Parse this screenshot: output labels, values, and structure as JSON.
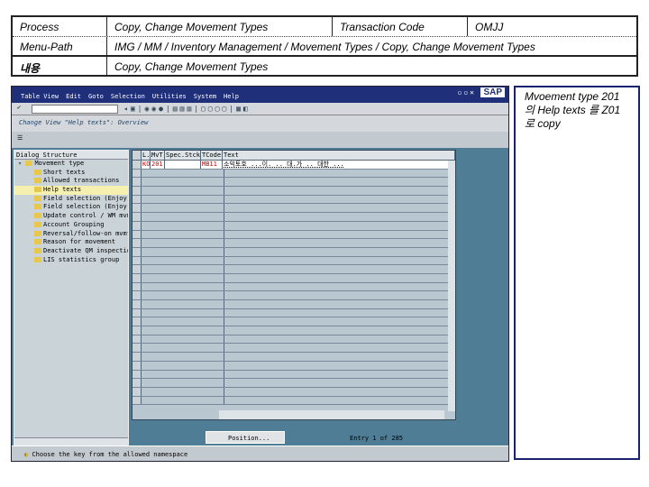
{
  "header": {
    "process_label": "Process",
    "process_value": "Copy, Change Movement Types",
    "tcode_label": "Transaction Code",
    "tcode_value": "OMJJ",
    "menupath_label": "Menu-Path",
    "menupath_value": "IMG / MM / Inventory Management / Movement Types / Copy, Change Movement Types",
    "content_label": "내용",
    "content_value": "Copy, Change Movement Types"
  },
  "sap": {
    "menu": [
      "Table View",
      "Edit",
      "Goto",
      "Selection",
      "Utilities",
      "System",
      "Help"
    ],
    "logo": "SAP",
    "screen_title": "Change View \"Help texts\": Overview",
    "tree": {
      "title": "Dialog Structure",
      "root": "Movement type",
      "items": [
        "Short texts",
        "Allowed transactions",
        "Help texts",
        "Field selection (Enjoy)",
        "Field selection (Enjoy)",
        "Update control / WM mvmt",
        "Account Grouping",
        "Reversal/follow-on mvmt",
        "Reason for movement",
        "Deactivate QM inspection",
        "LIS statistics group"
      ]
    },
    "table": {
      "columns": [
        "L..",
        "MvT",
        "Spec.Stck",
        "TCode",
        "Text"
      ],
      "row": {
        "lang": "KO",
        "mvt": "201",
        "spec": "",
        "tcode": "MB11",
        "text": "소익토호 ...이. .. 대.가 .. 대한 ..."
      }
    },
    "position_label": "Position...",
    "entry_text": "Entry 1 of 285",
    "status_text": "Choose the key from the allowed namespace"
  },
  "note": {
    "line1": "Mvoement type 201",
    "line2": "의 Help texts 를 Z01",
    "line3": "로  copy"
  }
}
